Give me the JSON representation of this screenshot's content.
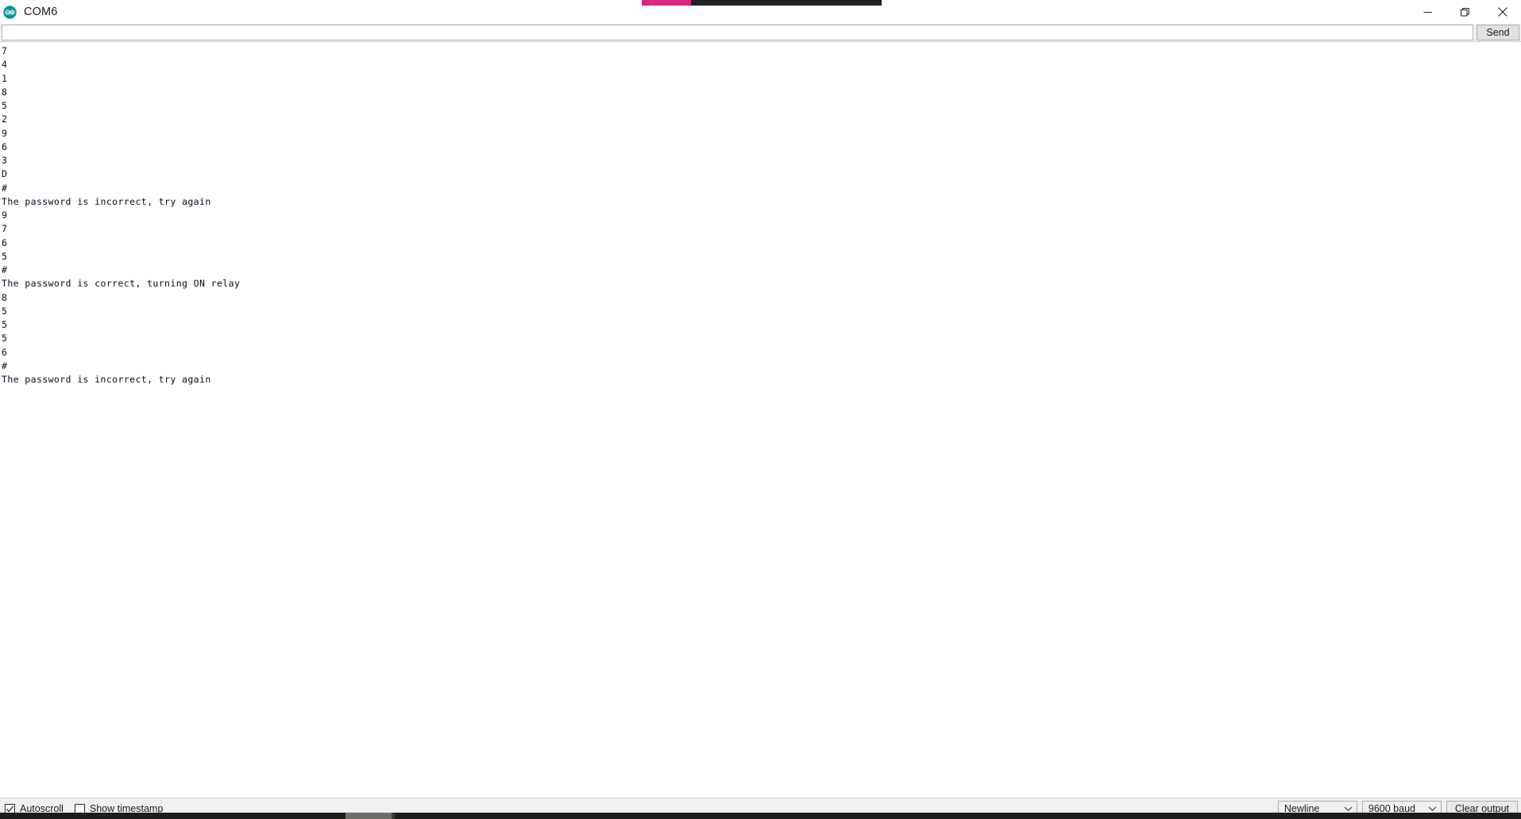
{
  "window": {
    "title": "COM6",
    "app_icon": "arduino-logo-icon",
    "minimize_label": "Minimize",
    "maximize_label": "Restore",
    "close_label": "Close"
  },
  "overlay": {
    "accent_pink": "#d62a7e",
    "accent_dark": "#1f2022"
  },
  "send_bar": {
    "input_value": "",
    "input_placeholder": "",
    "send_label": "Send"
  },
  "console": {
    "lines": [
      "7",
      "4",
      "1",
      "8",
      "5",
      "2",
      "9",
      "6",
      "3",
      "D",
      "#",
      "The password is incorrect, try again",
      "9",
      "7",
      "6",
      "5",
      "#",
      "The password is correct, turning ON relay",
      "8",
      "5",
      "5",
      "5",
      "6",
      "#",
      "The password is incorrect, try again"
    ]
  },
  "status_bar": {
    "autoscroll_label": "Autoscroll",
    "autoscroll_checked": true,
    "timestamp_label": "Show timestamp",
    "timestamp_checked": false,
    "line_ending": "Newline",
    "baud_rate": "9600 baud",
    "clear_label": "Clear output"
  }
}
